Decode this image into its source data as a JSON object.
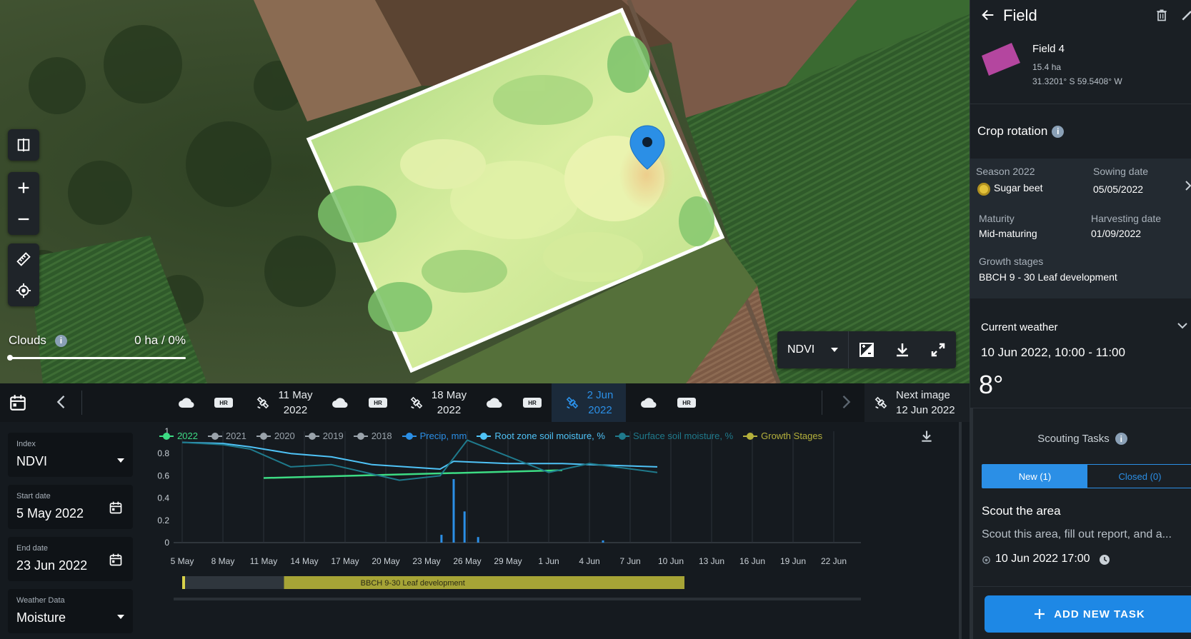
{
  "map": {
    "clouds_label": "Clouds",
    "clouds_info": "i",
    "clouds_value": "0 ha / 0%",
    "layer_select": "NDVI",
    "colors": {
      "field_light": "#e2f2a8",
      "field_mid": "#bfe08a",
      "field_dark": "#7cc36b",
      "pin": "#2b8fe6"
    }
  },
  "timeline": {
    "hr_label": "HR",
    "dates": [
      {
        "line1": "11 May",
        "line2": "2022"
      },
      {
        "line1": "18 May",
        "line2": "2022"
      },
      {
        "line1": "2 Jun",
        "line2": "2022"
      }
    ],
    "next_image": {
      "line1": "Next image",
      "line2": "12 Jun 2022"
    }
  },
  "form": {
    "index": {
      "label": "Index",
      "value": "NDVI"
    },
    "start_date": {
      "label": "Start date",
      "value": "5 May 2022"
    },
    "end_date": {
      "label": "End date",
      "value": "23 Jun 2022"
    },
    "weather_data": {
      "label": "Weather Data",
      "value": "Moisture"
    }
  },
  "chart_data": {
    "type": "line",
    "legend": [
      {
        "label": "2022",
        "color": "#3ddc84"
      },
      {
        "label": "2021",
        "color": "#9aa3ab"
      },
      {
        "label": "2020",
        "color": "#9aa3ab"
      },
      {
        "label": "2019",
        "color": "#9aa3ab"
      },
      {
        "label": "2018",
        "color": "#9aa3ab"
      },
      {
        "label": "Precip, mm",
        "color": "#2b8fe6"
      },
      {
        "label": "Root zone soil moisture, %",
        "color": "#4fc3f7"
      },
      {
        "label": "Surface soil moisture, %",
        "color": "#1f7a8c"
      },
      {
        "label": "Growth Stages",
        "color": "#b5b13c"
      }
    ],
    "y_ticks": [
      "0",
      "0.2",
      "0.4",
      "0.6",
      "0.8",
      "1"
    ],
    "ylim": [
      0,
      1
    ],
    "x_ticks": [
      "5 May",
      "8 May",
      "11 May",
      "14 May",
      "17 May",
      "20 May",
      "23 May",
      "26 May",
      "29 May",
      "1 Jun",
      "4 Jun",
      "7 Jun",
      "10 Jun",
      "13 Jun",
      "16 Jun",
      "19 Jun",
      "22 Jun"
    ],
    "xlim": [
      0,
      50
    ],
    "series": [
      {
        "name": "2022",
        "color": "#3ddc84",
        "width": 2.5,
        "points": [
          [
            6,
            0.58
          ],
          [
            28,
            0.65
          ]
        ]
      },
      {
        "name": "Root zone soil moisture, %",
        "color": "#4fc3f7",
        "width": 2,
        "points": [
          [
            0,
            0.9
          ],
          [
            3,
            0.89
          ],
          [
            5,
            0.86
          ],
          [
            8,
            0.8
          ],
          [
            11,
            0.77
          ],
          [
            14,
            0.7
          ],
          [
            19,
            0.66
          ],
          [
            20,
            0.73
          ],
          [
            24,
            0.71
          ],
          [
            28,
            0.71
          ],
          [
            30,
            0.7
          ],
          [
            35,
            0.68
          ]
        ]
      },
      {
        "name": "Surface soil moisture, %",
        "color": "#1f7a8c",
        "width": 2,
        "points": [
          [
            0,
            0.9
          ],
          [
            3,
            0.88
          ],
          [
            5,
            0.84
          ],
          [
            8,
            0.68
          ],
          [
            11,
            0.7
          ],
          [
            16,
            0.56
          ],
          [
            19,
            0.6
          ],
          [
            21,
            0.92
          ],
          [
            27,
            0.63
          ],
          [
            30,
            0.71
          ],
          [
            35,
            0.63
          ]
        ]
      }
    ],
    "precip": [
      [
        19.1,
        0.07
      ],
      [
        20,
        0.57
      ],
      [
        20.8,
        0.28
      ],
      [
        21.8,
        0.05
      ],
      [
        31,
        0.02
      ]
    ],
    "growth_stage": {
      "label": "BBCH 9-30 Leaf development",
      "start": 0,
      "split": 7.5,
      "end": 37
    }
  },
  "side": {
    "title": "Field",
    "field_name": "Field 4",
    "field_area": "15.4 ha",
    "field_coords": "31.3201° S 59.5408° W",
    "field_color": "#b4469f",
    "crop_rotation": "Crop rotation",
    "season_label": "Season 2022",
    "crop": "Sugar beet",
    "sowing_label": "Sowing date",
    "sowing_value": "05/05/2022",
    "maturity_label": "Maturity",
    "maturity_value": "Mid-maturing",
    "harvest_label": "Harvesting date",
    "harvest_value": "01/09/2022",
    "growth_label": "Growth stages",
    "growth_value": "BBCH 9 - 30 Leaf development",
    "weather_title": "Current weather",
    "weather_time": "10 Jun 2022, 10:00 - 11:00",
    "weather_temp": "8°",
    "scouting_title": "Scouting Tasks",
    "tab_new": "New (1)",
    "tab_closed": "Closed (0)",
    "task_title": "Scout the area",
    "task_desc": "Scout this area, fill out report, and a...",
    "task_date": "10 Jun 2022 17:00",
    "add_task": "ADD NEW TASK"
  }
}
